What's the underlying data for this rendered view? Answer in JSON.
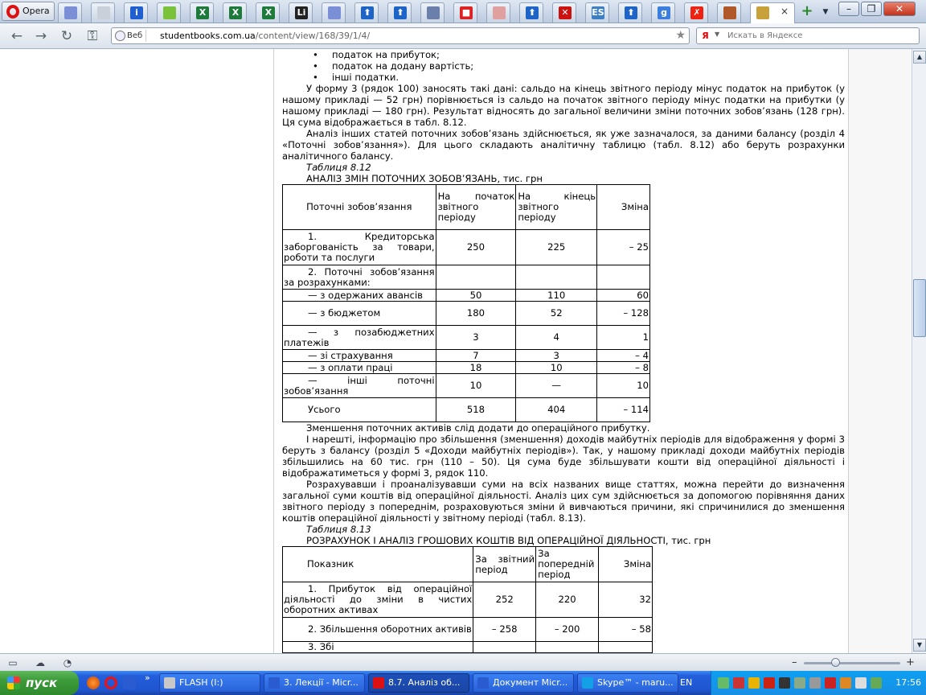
{
  "browser": {
    "menu_label": "Opera",
    "tabs": [
      {
        "icon": "page-icon",
        "color": "#7a8fd6"
      },
      {
        "icon": "blank-page-icon",
        "color": "#c9d0da"
      },
      {
        "icon": "info-icon",
        "color": "#1f5fd1",
        "glyph": "i"
      },
      {
        "icon": "apple-icon",
        "color": "#7ac23a"
      },
      {
        "icon": "excel-icon",
        "color": "#1d7a3a",
        "glyph": "X"
      },
      {
        "icon": "excel-icon",
        "color": "#1d7a3a",
        "glyph": "X"
      },
      {
        "icon": "excel-icon",
        "color": "#1d7a3a",
        "glyph": "X"
      },
      {
        "icon": "li-icon",
        "color": "#222",
        "glyph": "Li"
      },
      {
        "icon": "page-icon",
        "color": "#7a8fd6"
      },
      {
        "icon": "up-arrow-icon",
        "color": "#1e63c8",
        "glyph": "⬆"
      },
      {
        "icon": "up-arrow-icon",
        "color": "#1e63c8",
        "glyph": "⬆"
      },
      {
        "icon": "document-icon",
        "color": "#6a7faa"
      },
      {
        "icon": "red-logo-icon",
        "color": "#d22",
        "glyph": "■"
      },
      {
        "icon": "chart-icon",
        "color": "#e0a0a0"
      },
      {
        "icon": "up-arrow-icon",
        "color": "#1e63c8",
        "glyph": "⬆"
      },
      {
        "icon": "red-grid-icon",
        "color": "#c11",
        "glyph": "✕"
      },
      {
        "icon": "es-icon",
        "color": "#3d7fc4",
        "glyph": "ES"
      },
      {
        "icon": "up-arrow-icon",
        "color": "#1e63c8",
        "glyph": "⬆"
      },
      {
        "icon": "google-icon",
        "color": "#3c7ee0",
        "glyph": "g"
      },
      {
        "icon": "red-x-icon",
        "color": "#e21",
        "glyph": "✗"
      },
      {
        "icon": "books-icon",
        "color": "#b0582a"
      },
      {
        "icon": "graduation-cap-icon",
        "color": "#c7a13a",
        "active": true
      }
    ],
    "close_glyph": "×",
    "add_tab_glyph": "+",
    "window_controls": {
      "minimize": "–",
      "restore": "❐",
      "close": "✕"
    },
    "nav": {
      "back": "←",
      "forward": "→",
      "reload": "↻",
      "key": "⚿"
    },
    "address": {
      "badge": "Веб",
      "host": "studentbooks.com.ua",
      "path": "/content/view/168/39/1/4/"
    },
    "search": {
      "engine": "Я",
      "placeholder": "Искать в Яндексе"
    }
  },
  "article": {
    "bullets": [
      "податок на прибуток;",
      "податок на додану вартість;",
      "інші податки."
    ],
    "paragraph_1": "У форму 3 (рядок 100) заносять такі дані: сальдо на кінець звітного періоду мінус податок на прибуток (у нашому прикладі — 52 грн) порівнюється із сальдо на початок звітного періоду мінус податки на прибутки (у нашому прикладі — 180 грн). Результат відносять до загальної величини зміни поточних зобов’язань (128 грн). Ця сума відображається в табл. 8.12.",
    "paragraph_2": "Аналіз інших статей поточних зобов’язань здійснюється, як уже зазначалося, за даними балансу (розділ 4 «Поточні зобов’язання»). Для цього складають аналітичну таблицю (табл. 8.12) або беруть розрахунки аналітичного балансу.",
    "table1": {
      "caption": "Таблиця 8.12",
      "title": "АНАЛІЗ ЗМІН ПОТОЧНИХ ЗОБОВ’ЯЗАНЬ, тис. грн",
      "headers": [
        "Поточні зобов’язання",
        "На початок звітного періоду",
        "На кінець звітного періоду",
        "Зміна"
      ],
      "rows": [
        [
          "1. Кредиторська заборгованість за товари, роботи та послуги",
          "250",
          "225",
          "– 25"
        ],
        [
          "2. Поточні зобов’язання за розрахунками:",
          "",
          "",
          ""
        ],
        [
          "— з одержаних авансів",
          "50",
          "110",
          "60"
        ],
        [
          "— з бюджетом",
          "180",
          "52",
          "– 128"
        ],
        [
          "— з позабюджетних платежів",
          "3",
          "4",
          "1"
        ],
        [
          "— зі страхування",
          "7",
          "3",
          "– 4"
        ],
        [
          "— з оплати праці",
          "18",
          "10",
          "– 8"
        ],
        [
          "— інші поточні зобов’язання",
          "10",
          "—",
          "10"
        ],
        [
          "Усього",
          "518",
          "404",
          "– 114"
        ]
      ]
    },
    "paragraph_3": "Зменшення поточних активів слід додати до операційного прибутку.",
    "paragraph_4": "І нарешті, інформацію про збільшення (зменшення) доходів майбутніх періодів для відображення у формі 3 беруть з балансу (розділ 5 «Доходи майбутніх періодів»). Так, у нашому прикладі доходи майбутніх періодів збільшились на 60 тис. грн (110 – 50). Ця сума буде збільшувати кошти від операційної діяльності і відображатиметься у формі 3, рядок 110.",
    "paragraph_5": "Розрахувавши і проаналізувавши суми на всіх названих вище статтях, можна перейти до визначення загальної суми коштів від операційної діяльності. Аналіз цих сум здійснюється за допомогою порівняння даних звітного періоду з попереднім, розраховуються зміни й вивчаються причини, які спричинилися до зменшення коштів операційної діяльності у звітному періоді (табл. 8.13).",
    "table2": {
      "caption": "Таблиця 8.13",
      "title": "РОЗРАХУНОК І АНАЛІЗ ГРОШОВИХ КОШТІВ ВІД ОПЕРАЦІЙНОЇ ДІЯЛЬНОСТІ, тис. грн",
      "headers": [
        "Показник",
        "За звітний період",
        "За попередній період",
        "Зміна"
      ],
      "rows": [
        [
          "1. Прибуток від операційної діяльності до зміни в чистих оборотних активах",
          "252",
          "220",
          "32"
        ],
        [
          "2. Збільшення оборотних активів",
          "– 258",
          "– 200",
          "– 58"
        ],
        [
          "3. Збі",
          "",
          "",
          ""
        ]
      ]
    }
  },
  "scrollbar": {
    "up": "▲",
    "down": "▼"
  },
  "statusbar": {
    "zoom_minus": "–",
    "zoom_plus": "+"
  },
  "taskbar": {
    "start_label": "пуск",
    "more": "»",
    "tasks": [
      {
        "label": "FLASH (I:)",
        "color": "#c8c8c8"
      },
      {
        "label": "3. Лекції - Micr...",
        "color": "#2a5bd0"
      },
      {
        "label": "8.7. Аналіз об...",
        "color": "#d11",
        "active": true
      },
      {
        "label": "Документ Micr...",
        "color": "#2a5bd0"
      },
      {
        "label": "Skype™ - maru...",
        "color": "#14a0e6"
      }
    ],
    "language": "EN",
    "clock": "17:56"
  }
}
